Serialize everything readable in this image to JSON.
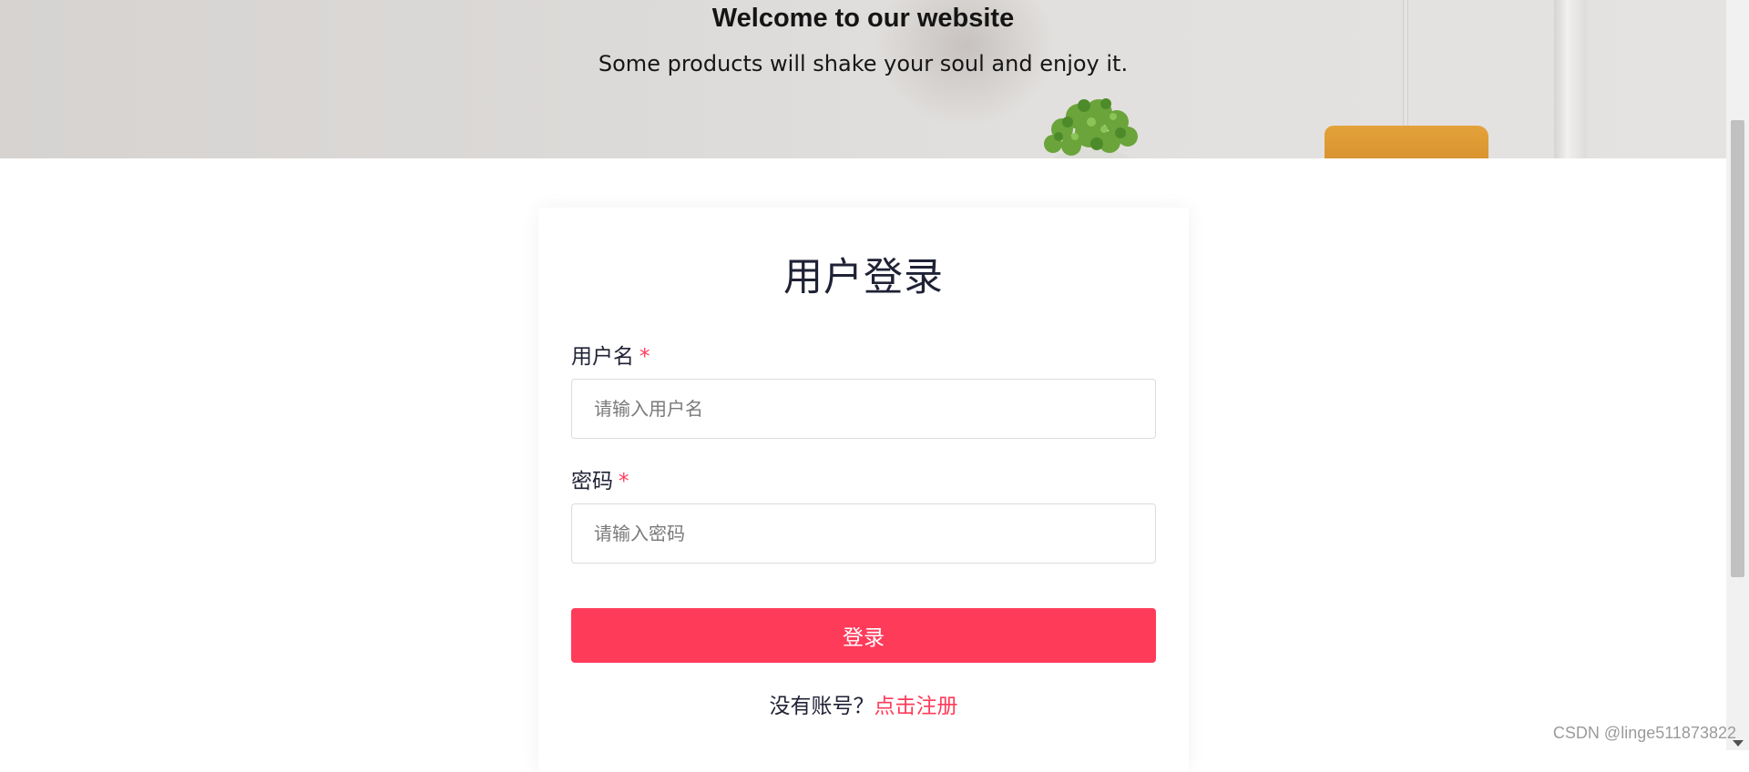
{
  "hero": {
    "title": "Welcome to our website",
    "subtitle": "Some products will shake your soul and enjoy it."
  },
  "login": {
    "title": "用户登录",
    "username_label": "用户名",
    "username_placeholder": "请输入用户名",
    "password_label": "密码",
    "password_placeholder": "请输入密码",
    "required_mark": "*",
    "submit_label": "登录",
    "register_prompt": "没有账号？",
    "register_link": "点击注册"
  },
  "watermark": "CSDN @linge511873822",
  "colors": {
    "accent": "#ff3b5a",
    "text": "#1f2235",
    "chair": "#e4a23b"
  }
}
